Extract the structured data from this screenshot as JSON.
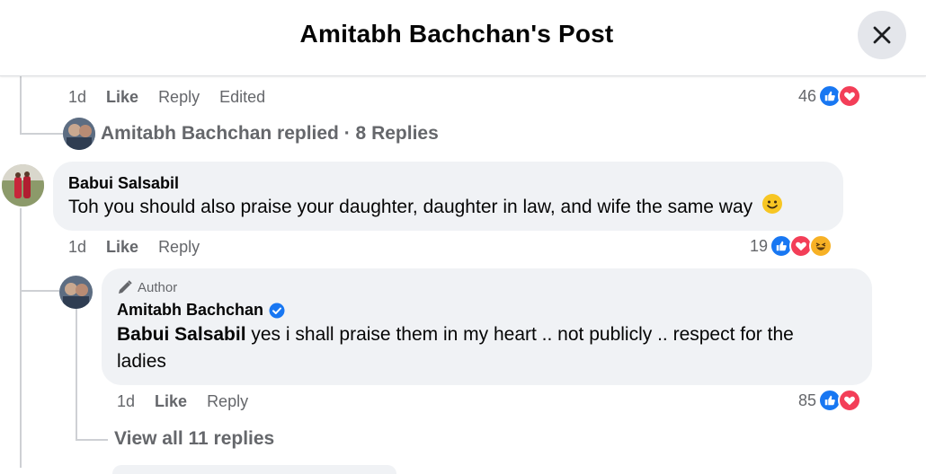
{
  "header": {
    "title": "Amitabh Bachchan's Post",
    "close_icon": "close-icon"
  },
  "prev_comment": {
    "meta": {
      "time": "1d",
      "like": "Like",
      "reply": "Reply",
      "edited": "Edited"
    },
    "reaction_count": "46",
    "reactions": [
      "like-icon",
      "love-icon"
    ],
    "replied": "Amitabh Bachchan replied · 8 Replies"
  },
  "comment": {
    "author": "Babui Salsabil",
    "text": "Toh you should also praise your daughter, daughter in law, and wife the same way",
    "emoji": "🙂",
    "meta": {
      "time": "1d",
      "like": "Like",
      "reply": "Reply"
    },
    "reaction_count": "19",
    "reactions": [
      "like-icon",
      "love-icon",
      "haha-icon"
    ]
  },
  "reply": {
    "badge": "Author",
    "author": "Amitabh Bachchan",
    "mention": "Babui Salsabil",
    "text": " yes i shall praise them in my heart .. not publicly .. respect for the ladies",
    "meta": {
      "time": "1d",
      "like": "Like",
      "reply": "Reply"
    },
    "reaction_count": "85",
    "reactions": [
      "like-icon",
      "love-icon"
    ]
  },
  "view_all": "View all 11 replies",
  "colors": {
    "like": "#1877f2",
    "love": "#f33e58",
    "haha": "#f7b125",
    "verified": "#1877f2"
  }
}
